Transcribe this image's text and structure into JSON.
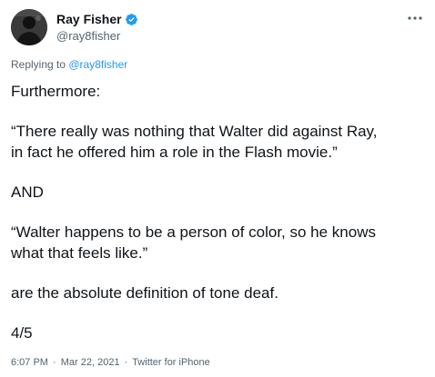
{
  "author": {
    "display_name": "Ray Fisher",
    "handle": "@ray8fisher",
    "verified": true
  },
  "reply": {
    "prefix": "Replying to ",
    "mention": "@ray8fisher"
  },
  "tweet": {
    "lines": [
      "Furthermore:",
      "“There really was nothing that Walter did against Ray,",
      "in fact he offered him a role in the Flash movie.”",
      "AND",
      "“Walter happens to be a person of color, so he knows",
      "what that feels like.”",
      "are the absolute definition of tone deaf.",
      "4/5"
    ]
  },
  "meta": {
    "time": "6:07 PM",
    "separator": "·",
    "date": "Mar 22, 2021",
    "source": "Twitter for iPhone"
  },
  "icons": {
    "verified": "verified-badge-icon",
    "more": "more-options-icon"
  },
  "colors": {
    "accent": "#1d9bf0",
    "text": "#0f1419",
    "secondary": "#536471"
  }
}
